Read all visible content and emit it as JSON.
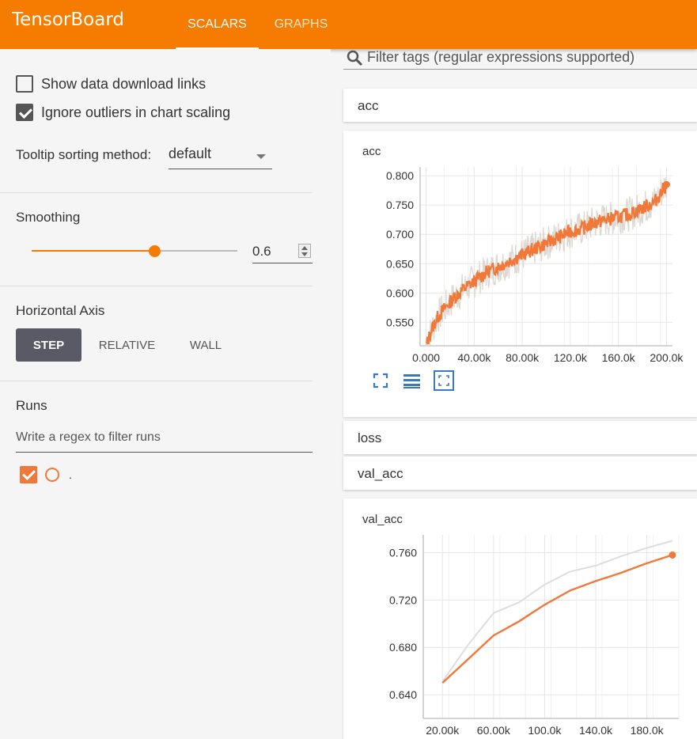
{
  "app": {
    "title": "TensorBoard",
    "accent": "#f57c00"
  },
  "tabs": [
    {
      "label": "SCALARS",
      "active": true
    },
    {
      "label": "GRAPHS",
      "active": false
    }
  ],
  "sidebar": {
    "show_download_label": "Show data download links",
    "show_download_checked": false,
    "ignore_outliers_label": "Ignore outliers in chart scaling",
    "ignore_outliers_checked": true,
    "tooltip_label": "Tooltip sorting method:",
    "tooltip_value": "default",
    "smoothing_title": "Smoothing",
    "smoothing_value": "0.6",
    "smoothing_fraction": 0.6,
    "haxis_title": "Horizontal Axis",
    "haxis_options": [
      "STEP",
      "RELATIVE",
      "WALL"
    ],
    "haxis_selected": "STEP",
    "runs_title": "Runs",
    "runs_filter_placeholder": "Write a regex to filter runs",
    "runs": [
      {
        "name": ".",
        "checked": true,
        "color": "#f07838"
      }
    ]
  },
  "main": {
    "filter_placeholder": "Filter tags (regular expressions supported)",
    "categories": [
      "acc",
      "loss",
      "val_acc"
    ],
    "icons": [
      "fit-domain-icon",
      "toggle-log-scale-icon",
      "expand-chart-icon"
    ]
  },
  "chart_data": [
    {
      "type": "line",
      "title": "acc",
      "x_ticks": [
        "0.000",
        "40.00k",
        "80.00k",
        "120.0k",
        "160.0k",
        "200.0k"
      ],
      "y_ticks": [
        "0.550",
        "0.600",
        "0.650",
        "0.700",
        "0.750",
        "0.800"
      ],
      "xlim": [
        -5000,
        205000
      ],
      "ylim": [
        0.51,
        0.815
      ],
      "series": [
        {
          "role": "smoothed",
          "color": "#f07838",
          "x": [
            0,
            5000,
            10000,
            20000,
            30000,
            40000,
            50000,
            60000,
            70000,
            80000,
            90000,
            100000,
            110000,
            120000,
            130000,
            140000,
            150000,
            160000,
            170000,
            180000,
            190000,
            200000
          ],
          "y": [
            0.51,
            0.54,
            0.56,
            0.585,
            0.605,
            0.62,
            0.635,
            0.645,
            0.655,
            0.665,
            0.675,
            0.685,
            0.695,
            0.705,
            0.71,
            0.72,
            0.725,
            0.73,
            0.735,
            0.745,
            0.755,
            0.785
          ]
        }
      ]
    },
    {
      "type": "line",
      "title": "val_acc",
      "x_ticks": [
        "20.00k",
        "60.00k",
        "100.0k",
        "140.0k",
        "180.0k"
      ],
      "y_ticks": [
        "0.640",
        "0.680",
        "0.720",
        "0.760"
      ],
      "xlim": [
        5000,
        205000
      ],
      "ylim": [
        0.62,
        0.775
      ],
      "series": [
        {
          "role": "raw",
          "color": "#dddddd",
          "x": [
            20000,
            40000,
            60000,
            80000,
            100000,
            120000,
            140000,
            160000,
            180000,
            200000
          ],
          "y": [
            0.651,
            0.682,
            0.709,
            0.718,
            0.733,
            0.744,
            0.749,
            0.757,
            0.764,
            0.77
          ]
        },
        {
          "role": "smoothed",
          "color": "#f07838",
          "x": [
            20000,
            40000,
            60000,
            80000,
            100000,
            120000,
            140000,
            160000,
            180000,
            200000
          ],
          "y": [
            0.65,
            0.67,
            0.69,
            0.702,
            0.716,
            0.728,
            0.736,
            0.743,
            0.751,
            0.758
          ]
        }
      ]
    }
  ]
}
